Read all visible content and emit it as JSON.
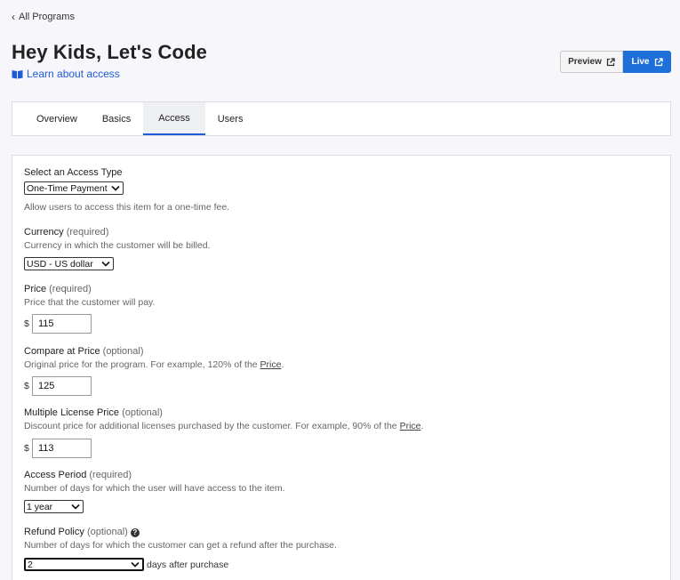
{
  "nav": {
    "back_label": "All Programs"
  },
  "header": {
    "title": "Hey Kids, Let's Code",
    "learn_label": "Learn about access"
  },
  "actions": {
    "preview_label": "Preview",
    "live_label": "Live"
  },
  "tabs": [
    {
      "label": "Overview",
      "active": false
    },
    {
      "label": "Basics",
      "active": false
    },
    {
      "label": "Access",
      "active": true
    },
    {
      "label": "Users",
      "active": false
    }
  ],
  "form": {
    "access_type": {
      "label": "Select an Access Type",
      "value": "One-Time Payment",
      "help": "Allow users to access this item for a one-time fee."
    },
    "currency": {
      "label": "Currency",
      "hint": "(required)",
      "help": "Currency in which the customer will be billed.",
      "value": "USD - US dollar"
    },
    "price": {
      "label": "Price",
      "hint": "(required)",
      "help": "Price that the customer will pay.",
      "symbol": "$",
      "value": "115"
    },
    "compare_price": {
      "label": "Compare at Price",
      "hint": "(optional)",
      "help_prefix": "Original price for the program. For example, 120% of the ",
      "help_link": "Price",
      "help_suffix": ".",
      "symbol": "$",
      "value": "125"
    },
    "multi_license": {
      "label": "Multiple License Price",
      "hint": "(optional)",
      "help_prefix": "Discount price for additional licenses purchased by the customer. For example, 90% of the ",
      "help_link": "Price",
      "help_suffix": ".",
      "symbol": "$",
      "value": "113"
    },
    "access_period": {
      "label": "Access Period",
      "hint": "(required)",
      "help": "Number of days for which the user will have access to the item.",
      "value": "1 year"
    },
    "refund": {
      "label": "Refund Policy",
      "hint": "(optional)",
      "help": "Number of days for which the customer can get a refund after the purchase.",
      "value": "2",
      "after": "days after purchase"
    }
  },
  "colors": {
    "accent": "#1e6fd9",
    "link": "#1e5bd8"
  }
}
